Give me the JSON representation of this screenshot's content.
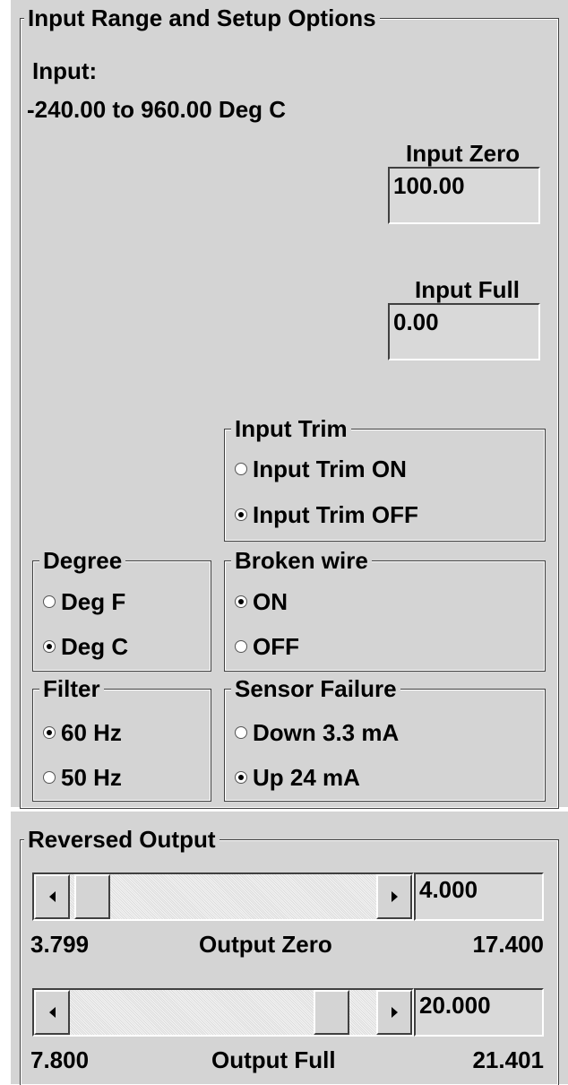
{
  "setup": {
    "title": "Input Range and Setup Options",
    "input_label": "Input:",
    "input_range": "-240.00 to 960.00 Deg C",
    "input_zero_label": "Input Zero",
    "input_zero_value": "100.00",
    "input_full_label": "Input Full",
    "input_full_value": "0.00"
  },
  "input_trim": {
    "title": "Input Trim",
    "options": [
      "Input Trim ON",
      "Input Trim OFF"
    ],
    "selected": "Input Trim OFF"
  },
  "degree": {
    "title": "Degree",
    "options": [
      "Deg F",
      "Deg C"
    ],
    "selected": "Deg C"
  },
  "broken_wire": {
    "title": "Broken wire",
    "options": [
      "ON",
      "OFF"
    ],
    "selected": "ON"
  },
  "filter": {
    "title": "Filter",
    "options": [
      "60 Hz",
      "50 Hz"
    ],
    "selected": "60 Hz"
  },
  "sensor_failure": {
    "title": "Sensor Failure",
    "options": [
      "Down 3.3 mA",
      "Up 24 mA"
    ],
    "selected": "Up 24 mA"
  },
  "reversed_output": {
    "title": "Reversed Output",
    "zero": {
      "value": "4.000",
      "min": "3.799",
      "label": "Output Zero",
      "max": "17.400",
      "position": 0.015
    },
    "full": {
      "value": "20.000",
      "min": "7.800",
      "label": "Output Full",
      "max": "21.401",
      "position": 0.9
    }
  }
}
